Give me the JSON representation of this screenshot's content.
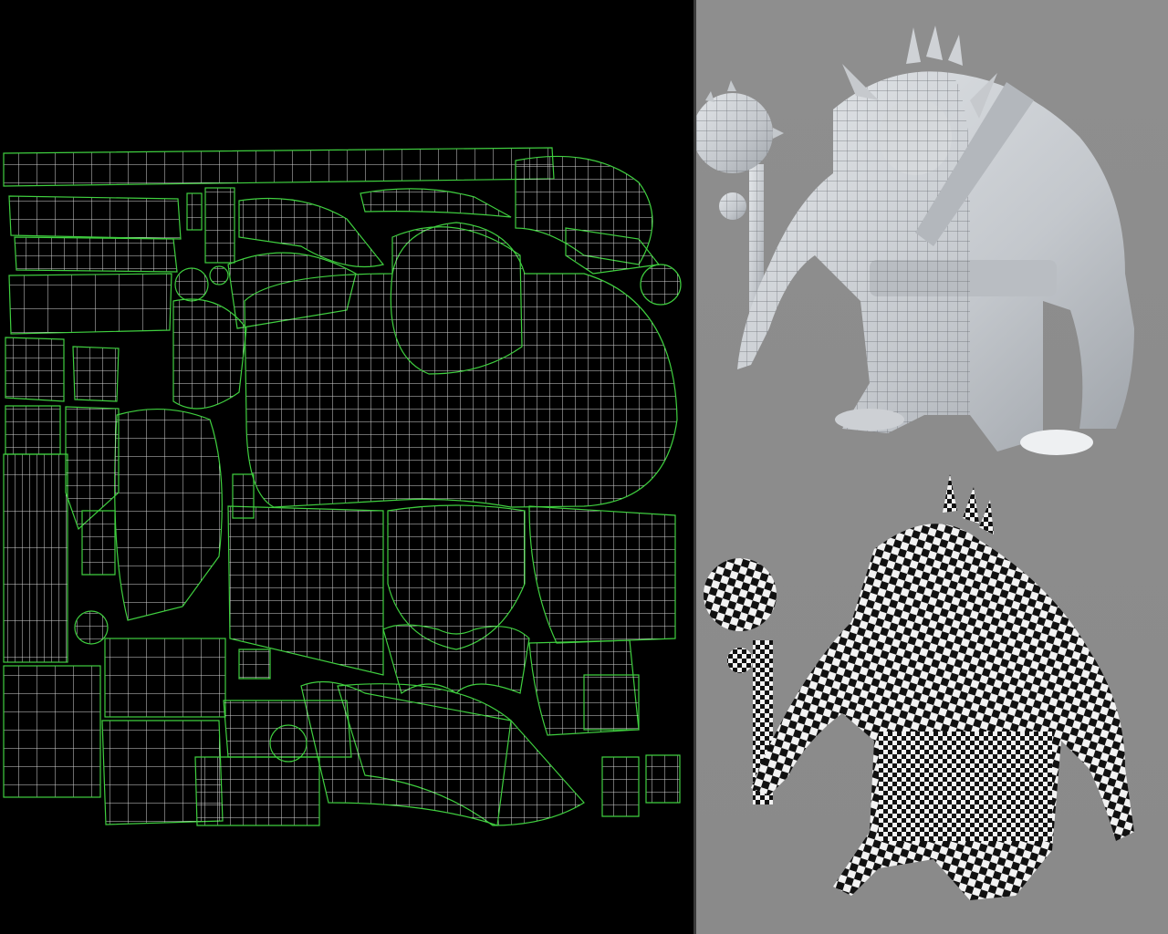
{
  "colors": {
    "uv_background": "#000000",
    "uv_island_border": "#3fcf3f",
    "uv_wire": "#d8d8d8",
    "viewport_background": "#8c8c8c",
    "model_shaded": "#c9ccd0",
    "checker_dark": "#111111",
    "checker_light": "#f2f2f2"
  },
  "panels": {
    "uv_editor": "uv-texture-layout",
    "viewport_top": "wireframe-shaded-troll-model",
    "viewport_bottom": "checker-textured-troll-model"
  }
}
